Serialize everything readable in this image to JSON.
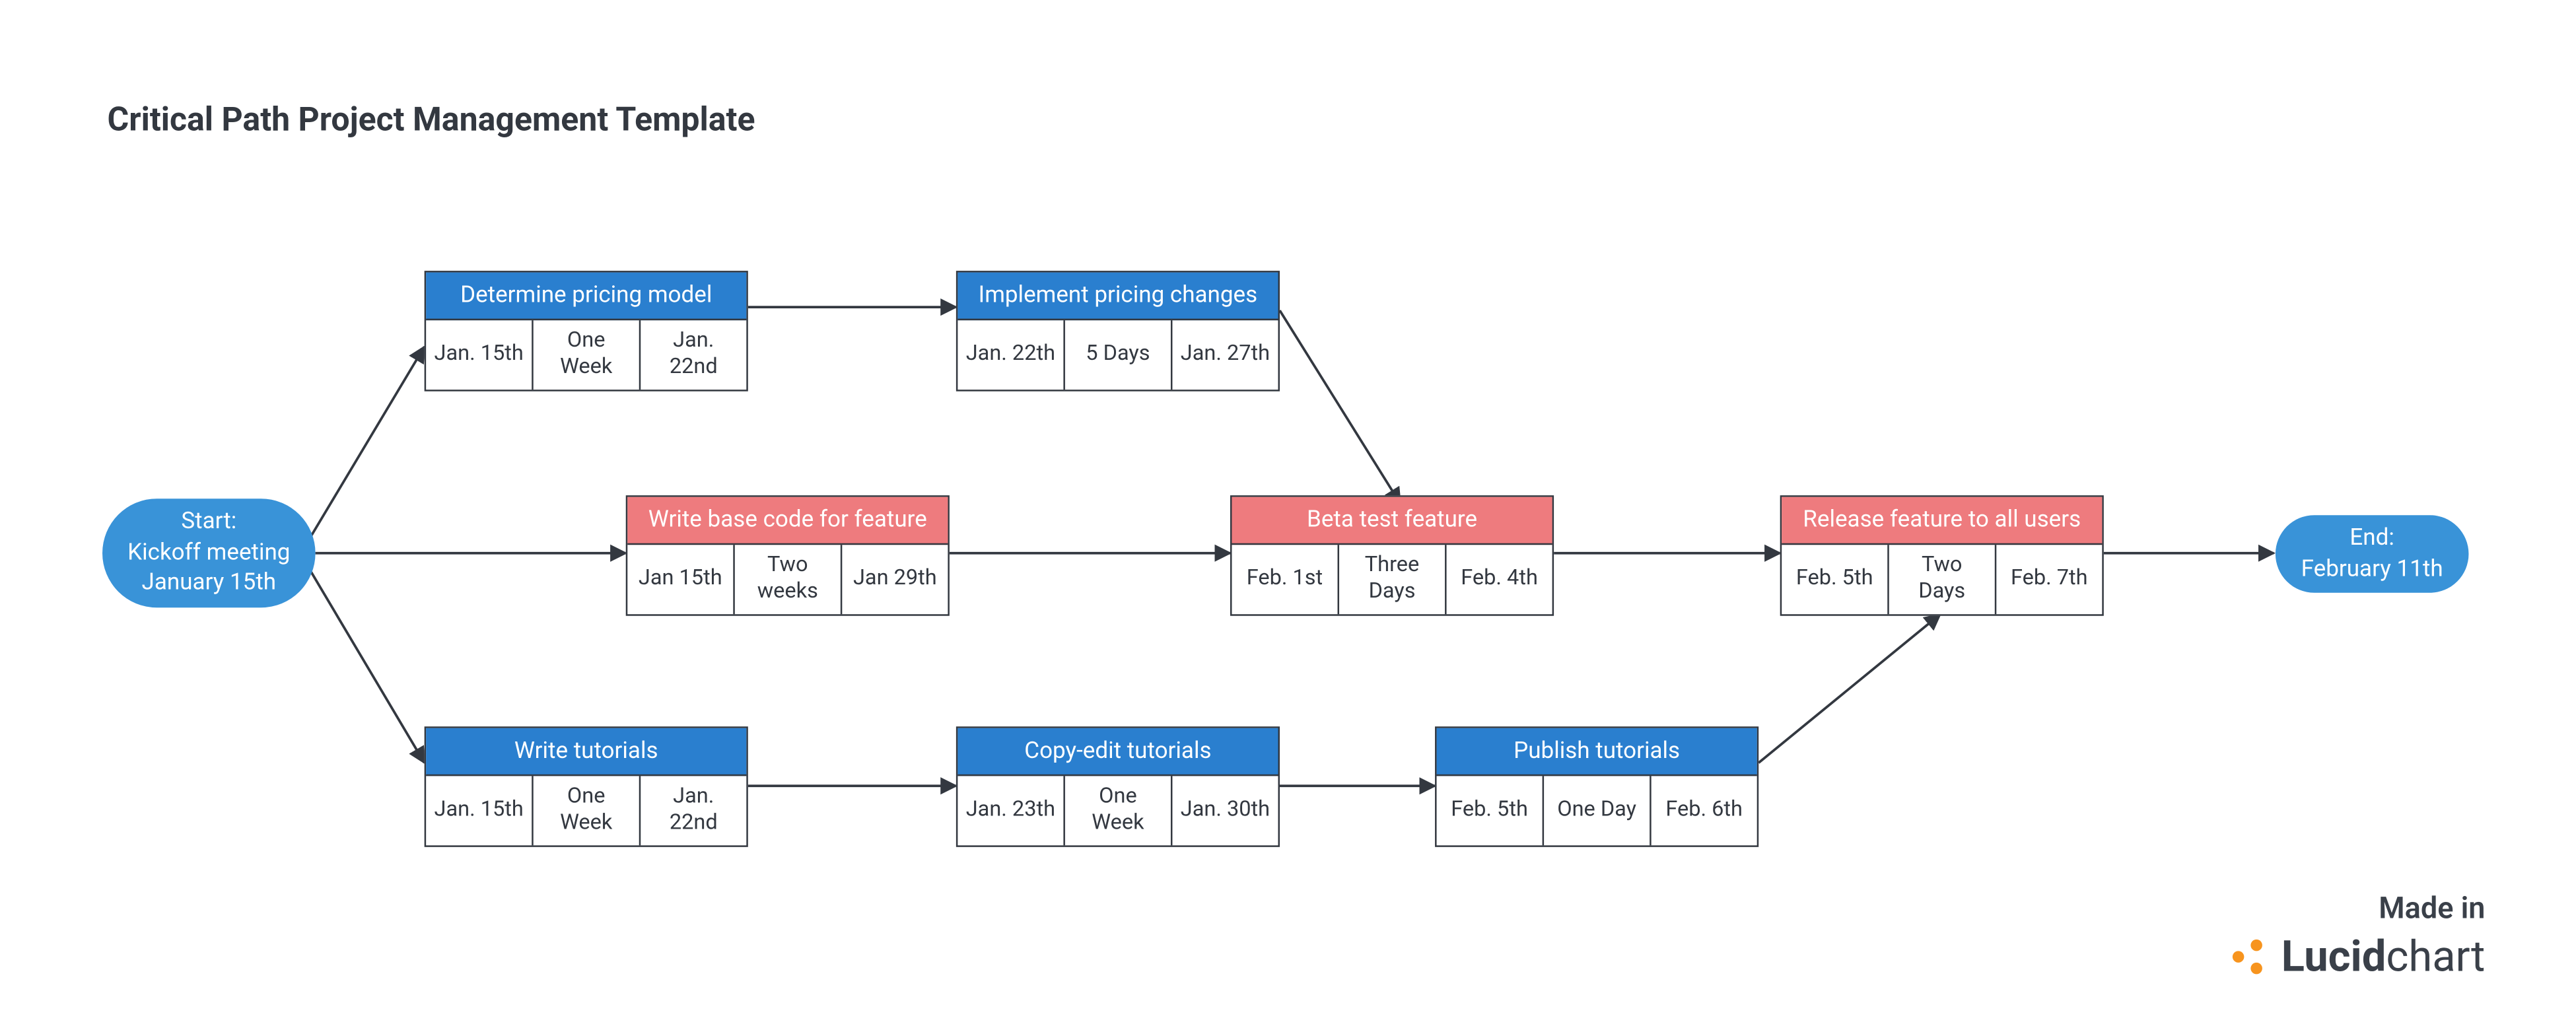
{
  "title": "Critical Path Project Management Template",
  "start": {
    "line1": "Start:",
    "line2": "Kickoff meeting",
    "line3": "January 15th"
  },
  "end": {
    "line1": "End:",
    "line2": "February 11th"
  },
  "tasks": {
    "pricingModel": {
      "title": "Determine pricing model",
      "start": "Jan. 15th",
      "duration": "One Week",
      "end": "Jan. 22nd",
      "color": "blue"
    },
    "pricingChanges": {
      "title": "Implement pricing changes",
      "start": "Jan. 22th",
      "duration": "5 Days",
      "end": "Jan. 27th",
      "color": "blue"
    },
    "baseCode": {
      "title": "Write base code for feature",
      "start": "Jan 15th",
      "duration": "Two weeks",
      "end": "Jan 29th",
      "color": "red"
    },
    "betaTest": {
      "title": "Beta test feature",
      "start": "Feb. 1st",
      "duration": "Three Days",
      "end": "Feb. 4th",
      "color": "red"
    },
    "release": {
      "title": "Release feature to all users",
      "start": "Feb. 5th",
      "duration": "Two Days",
      "end": "Feb. 7th",
      "color": "red"
    },
    "writeTut": {
      "title": "Write tutorials",
      "start": "Jan. 15th",
      "duration": "One Week",
      "end": "Jan. 22nd",
      "color": "blue"
    },
    "copyEdit": {
      "title": "Copy-edit tutorials",
      "start": "Jan. 23th",
      "duration": "One Week",
      "end": "Jan. 30th",
      "color": "blue"
    },
    "publishTut": {
      "title": "Publish tutorials",
      "start": "Feb. 5th",
      "duration": "One Day",
      "end": "Feb. 6th",
      "color": "blue"
    }
  },
  "edges": [
    [
      "start",
      "pricingModel"
    ],
    [
      "start",
      "baseCode"
    ],
    [
      "start",
      "writeTut"
    ],
    [
      "pricingModel",
      "pricingChanges"
    ],
    [
      "pricingChanges",
      "betaTest"
    ],
    [
      "baseCode",
      "betaTest"
    ],
    [
      "betaTest",
      "release"
    ],
    [
      "writeTut",
      "copyEdit"
    ],
    [
      "copyEdit",
      "publishTut"
    ],
    [
      "publishTut",
      "release"
    ],
    [
      "release",
      "end"
    ]
  ],
  "branding": {
    "made_in": "Made in",
    "product_bold": "Lucid",
    "product_rest": "chart"
  }
}
